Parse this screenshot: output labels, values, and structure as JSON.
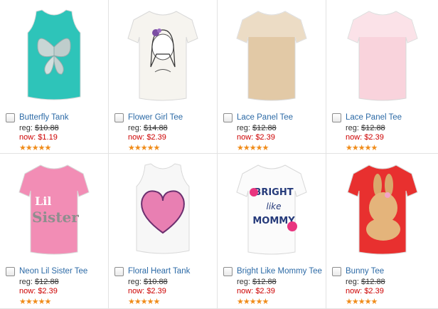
{
  "products": [
    {
      "name": "Butterfly Tank",
      "reg_label": "reg:",
      "reg_price": "$10.88",
      "now_label": "now:",
      "now_price": "$1.19",
      "stars": "★★★★★",
      "shirt": "tank",
      "color": "#2ec4b9",
      "print": "butterfly"
    },
    {
      "name": "Flower Girl Tee",
      "reg_label": "reg:",
      "reg_price": "$14.88",
      "now_label": "now:",
      "now_price": "$2.39",
      "stars": "★★★★★",
      "shirt": "tee",
      "color": "#f6f4ef",
      "print": "girl"
    },
    {
      "name": "Lace Panel Tee",
      "reg_label": "reg:",
      "reg_price": "$12.88",
      "now_label": "now:",
      "now_price": "$2.39",
      "stars": "★★★★★",
      "shirt": "tee",
      "color": "#e2c9a6",
      "print": "lace"
    },
    {
      "name": "Lace Panel Tee",
      "reg_label": "reg:",
      "reg_price": "$12.88",
      "now_label": "now:",
      "now_price": "$2.39",
      "stars": "★★★★★",
      "shirt": "tee",
      "color": "#f9d3dc",
      "print": "lace"
    },
    {
      "name": "Neon Lil Sister Tee",
      "reg_label": "reg:",
      "reg_price": "$12.88",
      "now_label": "now:",
      "now_price": "$2.39",
      "stars": "★★★★★",
      "shirt": "tee",
      "color": "#f28db5",
      "print": "lilsister"
    },
    {
      "name": "Floral Heart Tank",
      "reg_label": "reg:",
      "reg_price": "$10.88",
      "now_label": "now:",
      "now_price": "$2.39",
      "stars": "★★★★★",
      "shirt": "tank",
      "color": "#f7f7f7",
      "print": "heart"
    },
    {
      "name": "Bright Like Mommy Tee",
      "reg_label": "reg:",
      "reg_price": "$12.88",
      "now_label": "now:",
      "now_price": "$2.39",
      "stars": "★★★★★",
      "shirt": "tee",
      "color": "#fbfbfb",
      "print": "mommy"
    },
    {
      "name": "Bunny Tee",
      "reg_label": "reg:",
      "reg_price": "$12.88",
      "now_label": "now:",
      "now_price": "$2.39",
      "stars": "★★★★★",
      "shirt": "tee",
      "color": "#e8302f",
      "print": "bunny"
    }
  ],
  "prints": {
    "lil": "Lil",
    "sister": "Sister",
    "bright": "BRIGHT",
    "like": "like",
    "mommy": "MOMMY"
  }
}
